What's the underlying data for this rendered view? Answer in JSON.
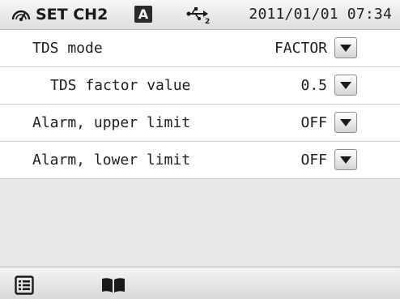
{
  "header": {
    "title": "SET CH2",
    "mode_badge": "A",
    "status_icon": "usb-icon",
    "usb_index": "2",
    "datetime": "2011/01/01 07:34"
  },
  "settings": [
    {
      "label": "TDS mode",
      "value": "FACTOR",
      "indented": false
    },
    {
      "label": "TDS factor value",
      "value": "0.5",
      "indented": true
    },
    {
      "label": "Alarm, upper limit",
      "value": "OFF",
      "indented": false
    },
    {
      "label": "Alarm, lower limit",
      "value": "OFF",
      "indented": false
    }
  ],
  "footer": {
    "icons": [
      "menu-list-icon",
      "manual-book-icon"
    ]
  },
  "colors": {
    "header_bg": "#e4e4e4",
    "empty_area_bg": "#e9e9e9",
    "text": "#1e1e1e",
    "badge_bg": "#2b2b2b"
  }
}
